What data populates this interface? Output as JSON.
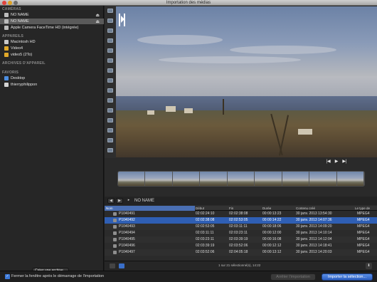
{
  "window": {
    "title": "Importation des médias"
  },
  "sidebar": {
    "cameras_heading": "CAMÉRAS",
    "cameras": [
      {
        "label": "NO NAME",
        "icon": "camera-icon",
        "eject": true,
        "selected": false
      },
      {
        "label": "NO NAME",
        "icon": "camera-icon",
        "eject": true,
        "selected": true
      },
      {
        "label": "Apple Camera FaceTime HD (intégrée)",
        "icon": "camera-icon",
        "eject": false,
        "selected": false
      }
    ],
    "devices_heading": "APPAREILS",
    "devices": [
      {
        "label": "Macintosh HD",
        "icon": "disk-icon"
      },
      {
        "label": "Video4",
        "icon": "volume-icon"
      },
      {
        "label": "video5 (2To)",
        "icon": "volume-icon"
      }
    ],
    "archives_heading": "ARCHIVES D'APPAREIL",
    "favorites_heading": "FAVORIS",
    "favorites": [
      {
        "label": "Desktop",
        "icon": "desktop-icon"
      },
      {
        "label": "thierryphilippon",
        "icon": "home-icon"
      }
    ],
    "create_archive_label": "Créer une archive..."
  },
  "viewer": {
    "transport": {
      "prev": "|◀",
      "play": "▶",
      "next": "▶|"
    }
  },
  "browser": {
    "path_label": "NO NAME",
    "columns": [
      "Nom",
      "Début",
      "Fin",
      "Durée",
      "Contenu créé",
      "Le type de"
    ],
    "rows": [
      {
        "name": "P1040491",
        "start": "02:02:24:10",
        "end": "02:02:38:08",
        "duration": "00:00:13:23",
        "created": "30 janv. 2013 13:54:30",
        "type": "MPEG4",
        "selected": false
      },
      {
        "name": "P1040492",
        "start": "02:02:38:08",
        "end": "02:02:53:05",
        "duration": "00:00:14:22",
        "created": "30 janv. 2013 14:07:36",
        "type": "MPEG4",
        "selected": true
      },
      {
        "name": "P1040493",
        "start": "02:02:53:05",
        "end": "02:03:11:11",
        "duration": "00:00:18:06",
        "created": "30 janv. 2013 14:09:20",
        "type": "MPEG4",
        "selected": false
      },
      {
        "name": "P1040494",
        "start": "02:03:11:11",
        "end": "02:03:23:11",
        "duration": "00:00:12:00",
        "created": "30 janv. 2013 14:10:14",
        "type": "MPEG4",
        "selected": false
      },
      {
        "name": "P1040495",
        "start": "02:03:23:11",
        "end": "02:03:39:19",
        "duration": "00:00:16:08",
        "created": "30 janv. 2013 14:12:04",
        "type": "MPEG4",
        "selected": false
      },
      {
        "name": "P1040496",
        "start": "02:03:39:19",
        "end": "02:03:52:06",
        "duration": "00:00:12:12",
        "created": "30 janv. 2013 14:18:41",
        "type": "MPEG4",
        "selected": false
      },
      {
        "name": "P1040497",
        "start": "02:03:52:06",
        "end": "02:04:05:18",
        "duration": "00:00:13:12",
        "created": "30 janv. 2013 14:20:03",
        "type": "MPEG4",
        "selected": false
      }
    ],
    "status": "1 sur 21 sélectionné(s), 14:22"
  },
  "footer": {
    "close_after_import_label": "Fermer la fenêtre après le démarrage de l'importation",
    "close_after_import_checked": true,
    "stop_import_label": "Arrêter l'importation",
    "import_selection_label": "Importer la sélection..."
  },
  "colors": {
    "accent": "#2f5fb4",
    "selection": "#5a5a5a",
    "import_button": "#3b78d8"
  }
}
